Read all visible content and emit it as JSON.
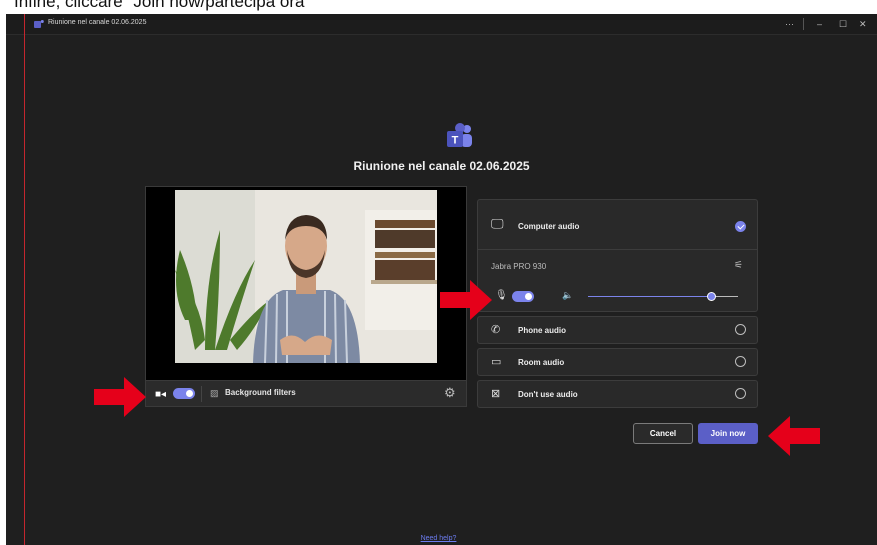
{
  "caption": "Infine, cliccare \"Join now/partecipa ora\"",
  "window": {
    "title": "Riunione nel canale 02.06.2025",
    "controls": [
      "···",
      "–",
      "☐",
      "✕"
    ]
  },
  "meeting_title": "Riunione nel canale 02.06.2025",
  "video_bar": {
    "background_filters_label": "Background filters",
    "camera_on": true
  },
  "audio": {
    "computer_audio": {
      "label": "Computer audio",
      "selected": true
    },
    "device_name": "Jabra PRO 930",
    "mic_on": true,
    "volume_level": 0.82,
    "options": [
      {
        "label": "Phone audio",
        "icon": "phone-icon",
        "selected": false
      },
      {
        "label": "Room audio",
        "icon": "room-icon",
        "selected": false
      },
      {
        "label": "Don't use audio",
        "icon": "no-audio-icon",
        "selected": false
      }
    ]
  },
  "buttons": {
    "cancel": "Cancel",
    "join": "Join now"
  },
  "help_link": "Need help?",
  "colors": {
    "accent": "#5b5fc7",
    "toggle": "#7b83eb",
    "arrow": "#e5001a",
    "background": "#1f1f1f"
  }
}
